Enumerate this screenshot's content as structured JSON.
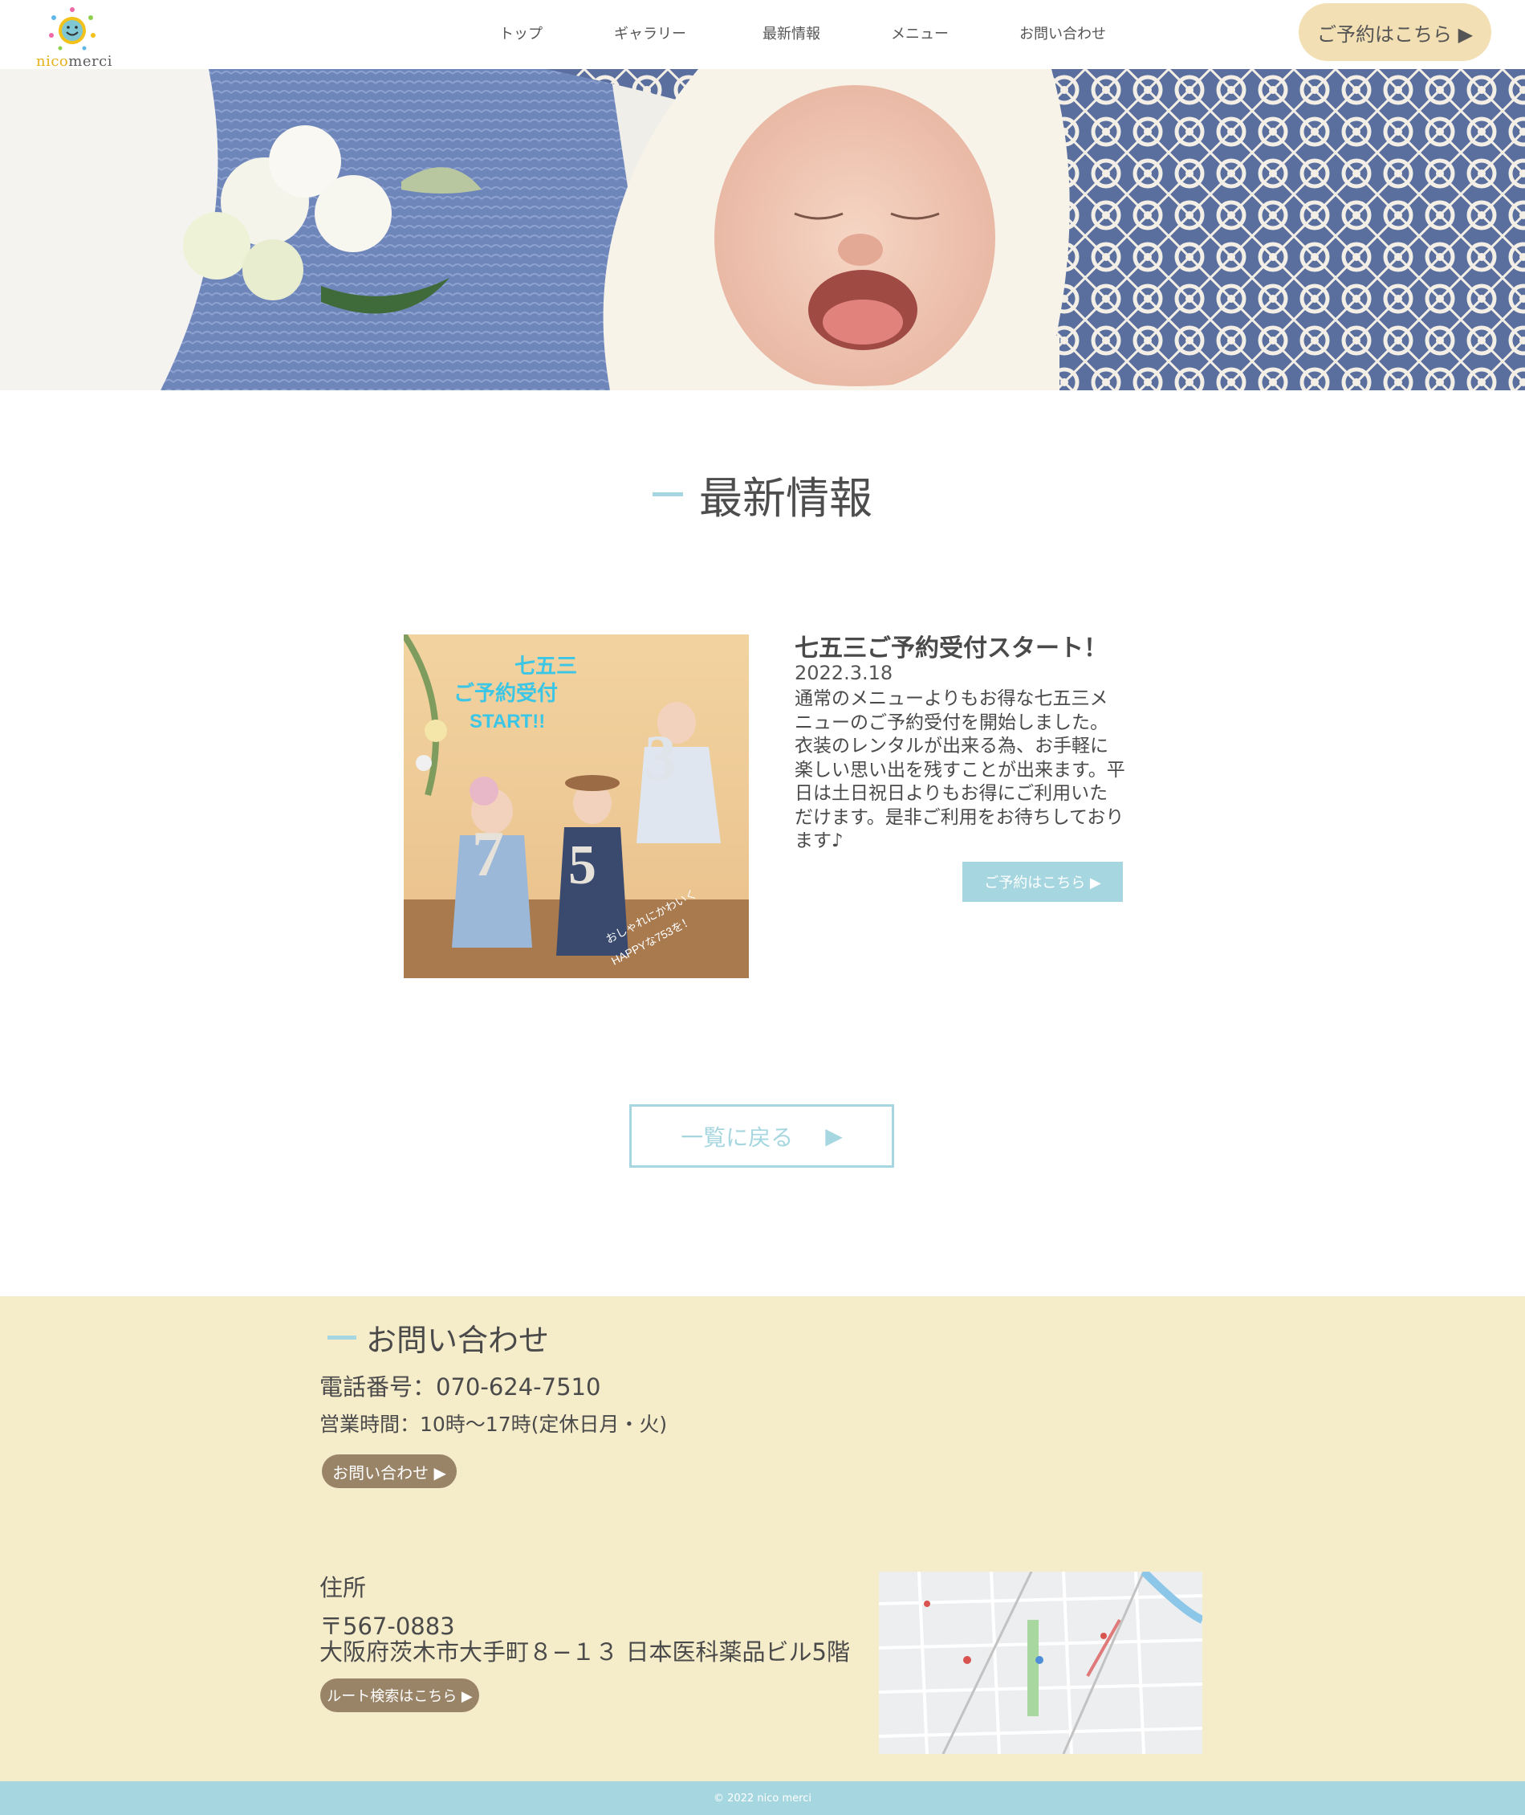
{
  "brand": {
    "logo_primary": "nico",
    "logo_secondary": "merci"
  },
  "nav": {
    "items": [
      {
        "label": "トップ"
      },
      {
        "label": "ギャラリー"
      },
      {
        "label": "最新情報"
      },
      {
        "label": "メニュー"
      },
      {
        "label": "お問い合わせ"
      }
    ],
    "reserve_label": "ご予約はこちら ▶"
  },
  "section": {
    "title": "最新情報"
  },
  "news": {
    "title": "七五三ご予約受付スタート！",
    "date": "2022.3.18",
    "body": "通常のメニューよりもお得な七五三メニューのご予約受付を開始しました。衣装のレンタルが出来る為、お手軽に楽しい思い出を残すことが出来ます。平日は土日祝日よりもお得にご利用いただけます。是非ご利用をお待ちしております♪",
    "button_label": "ご予約はこちら ▶",
    "image_text": {
      "line1": "七五三",
      "line2": "ご予約受付",
      "line3": "START!!",
      "line4": "おしゃれにかわいく",
      "line5": "HAPPYな753を！"
    }
  },
  "back_button": {
    "label": "一覧に戻る"
  },
  "contact": {
    "title": "お問い合わせ",
    "phone": "電話番号：070-624-7510",
    "hours": "営業時間：10時～17時(定休日月・火)",
    "button_label": "お問い合わせ ▶",
    "address_label": "住所",
    "zip": "〒567-0883",
    "address": "大阪府茨木市大手町８−１３ 日本医科薬品ビル5階",
    "route_label": "ルート検索はこちら ▶"
  },
  "footer": {
    "copyright": "© 2022 nico merci"
  },
  "colors": {
    "accent": "#a6d6df",
    "cta": "#f2dfb4",
    "contact_bg": "#f5ecca",
    "pill": "#9a8468"
  }
}
